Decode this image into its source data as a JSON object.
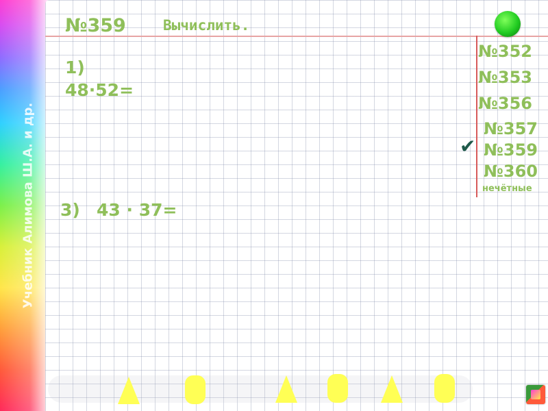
{
  "author_text": "Учебник Алимова Ш.А. и др.",
  "task": {
    "number": "№359",
    "instruction": "Вычислить."
  },
  "exercises": [
    {
      "label": "1)",
      "expression": "48·52="
    },
    {
      "label": "3)",
      "expression": "43 · 37="
    }
  ],
  "sidebar": {
    "items": [
      {
        "label": "№352"
      },
      {
        "label": "№353"
      },
      {
        "label": "№356"
      },
      {
        "label": "№357"
      },
      {
        "label": "№359",
        "checked": true
      },
      {
        "label": "№360"
      }
    ],
    "note": "нечётные"
  },
  "checkmark": "✔",
  "colors": {
    "text_green": "#8fbf5a",
    "margin_red": "#d75a5a",
    "indicator_green": "#22cc22",
    "highlight_yellow": "#ffff55"
  },
  "icons": [
    "green-circle-icon",
    "checkmark-icon",
    "navigation-icon"
  ]
}
